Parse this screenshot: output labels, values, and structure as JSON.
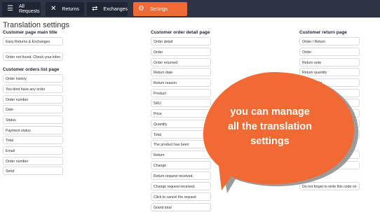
{
  "tabs": [
    {
      "label": "All Requests",
      "icon": "list-icon"
    },
    {
      "label": "Returns",
      "icon": "close-icon"
    },
    {
      "label": "Exchanges",
      "icon": "exchange-arrows-icon"
    },
    {
      "label": "Settings",
      "icon": "gear-icon"
    }
  ],
  "active_tab": "Settings",
  "accent_color": "#f26a33",
  "page_title": "Translation settings",
  "customer_page_main_title": {
    "heading": "Customer page main title",
    "fields": [
      "Easy Returns & Exchanges",
      "Order not found. Check your infon"
    ]
  },
  "customer_orders_list_page": {
    "heading": "Customer orders list page",
    "fields": [
      "Order history",
      "You dont have any order",
      "Order number",
      "Date",
      "Status",
      "Payment status",
      "Total",
      "Email",
      "Order number",
      "Send"
    ]
  },
  "customer_order_detail_page": {
    "heading": "Customer order detail page",
    "fields": [
      "Order detail",
      "Order",
      "Order returned",
      "Return date",
      "Return reason",
      "Product",
      "SKU",
      "Price",
      "Quantity",
      "Total",
      "The product has been",
      "Return",
      "Change",
      "Return request received.",
      "Change request received.",
      "Click to cancel the request",
      "Grand total"
    ]
  },
  "customer_return_page": {
    "heading": "Customer return page",
    "fields": [
      "Order / Return",
      "Order",
      "Return note",
      "Return quantity",
      "Return code",
      "",
      "",
      "",
      "",
      "",
      "",
      "",
      "Do not forget to write this code on"
    ]
  },
  "callout": {
    "lines": [
      "you can manage",
      "all the translation",
      "settings"
    ]
  }
}
